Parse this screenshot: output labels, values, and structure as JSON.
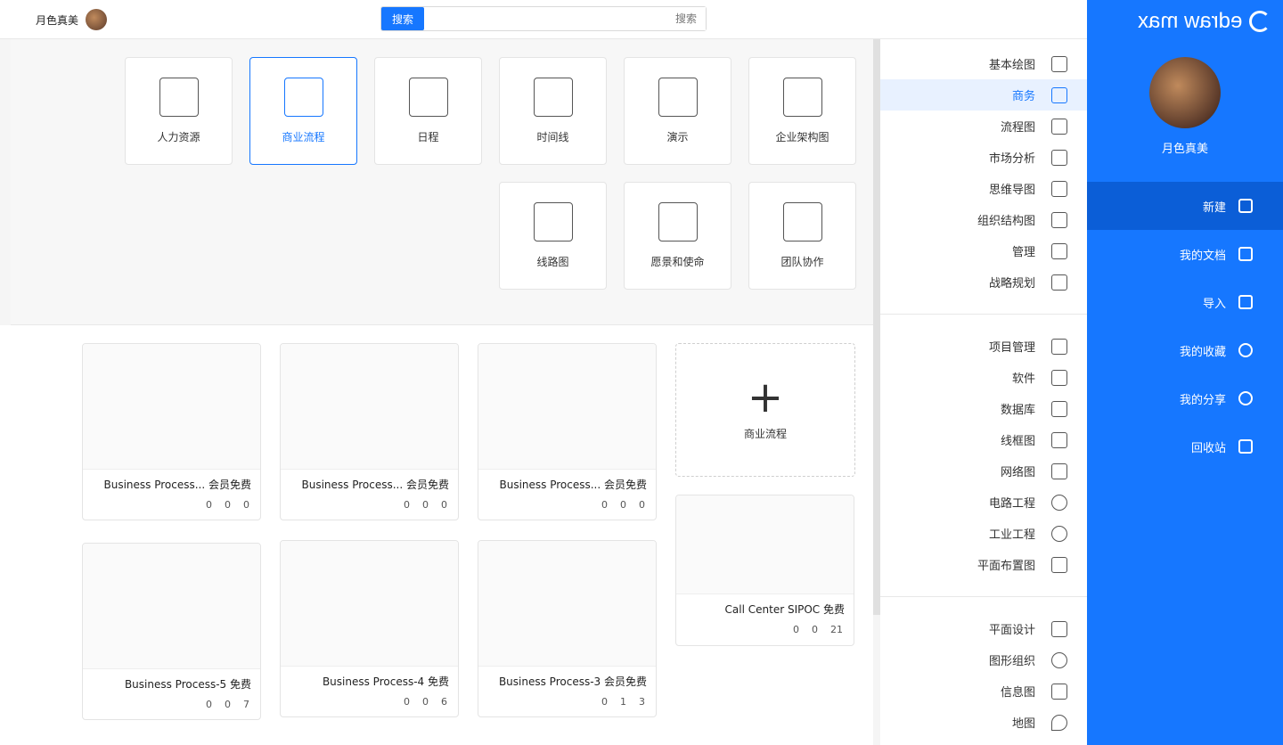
{
  "brand": {
    "name": "edraw max"
  },
  "sidebar": {
    "username": "月色真美",
    "menu": [
      {
        "label": "新建",
        "icon": "new-file-icon"
      },
      {
        "label": "我的文档",
        "icon": "document-icon"
      },
      {
        "label": "导入",
        "icon": "import-icon"
      },
      {
        "label": "我的收藏",
        "icon": "star-icon"
      },
      {
        "label": "我的分享",
        "icon": "share-icon"
      },
      {
        "label": "回收站",
        "icon": "trash-icon"
      }
    ]
  },
  "topbar": {
    "search_button": "搜索",
    "search_placeholder": "搜索",
    "username": "月色真美"
  },
  "categories": {
    "group1": [
      "基本绘图",
      "商务",
      "流程图",
      "市场分析",
      "思维导图",
      "组织结构图",
      "管理",
      "战略规划"
    ],
    "group2": [
      "项目管理",
      "软件",
      "数据库",
      "线框图",
      "网络图",
      "电路工程",
      "工业工程",
      "平面布置图"
    ],
    "group3": [
      "平面设计",
      "图形组织",
      "信息图",
      "地图"
    ]
  },
  "subcategories": [
    "企业架构图",
    "演示",
    "时间线",
    "日程",
    "商业流程",
    "人力资源",
    "团队协作",
    "愿景和使命",
    "线路图"
  ],
  "new_card": {
    "label": "商业流程"
  },
  "templates": [
    {
      "name": "Business Process...   会员免费",
      "likes": "0",
      "favs": "0",
      "copies": "0"
    },
    {
      "name": "Business Process...   会员免费",
      "likes": "0",
      "favs": "0",
      "copies": "0"
    },
    {
      "name": "Business Process...   会员免费",
      "likes": "0",
      "favs": "0",
      "copies": "0"
    },
    {
      "name": "Call Center SIPOC   免费",
      "likes": "0",
      "favs": "0",
      "copies": "21"
    },
    {
      "name": "Business Process-3   会员免费",
      "likes": "0",
      "favs": "1",
      "copies": "3"
    },
    {
      "name": "Business Process-4   免费",
      "likes": "0",
      "favs": "0",
      "copies": "6"
    },
    {
      "name": "Business Process-5   免费",
      "likes": "0",
      "favs": "0",
      "copies": "7"
    }
  ],
  "colors": {
    "accent": "#1677ff",
    "sidebar_active": "#0b5ed7"
  }
}
